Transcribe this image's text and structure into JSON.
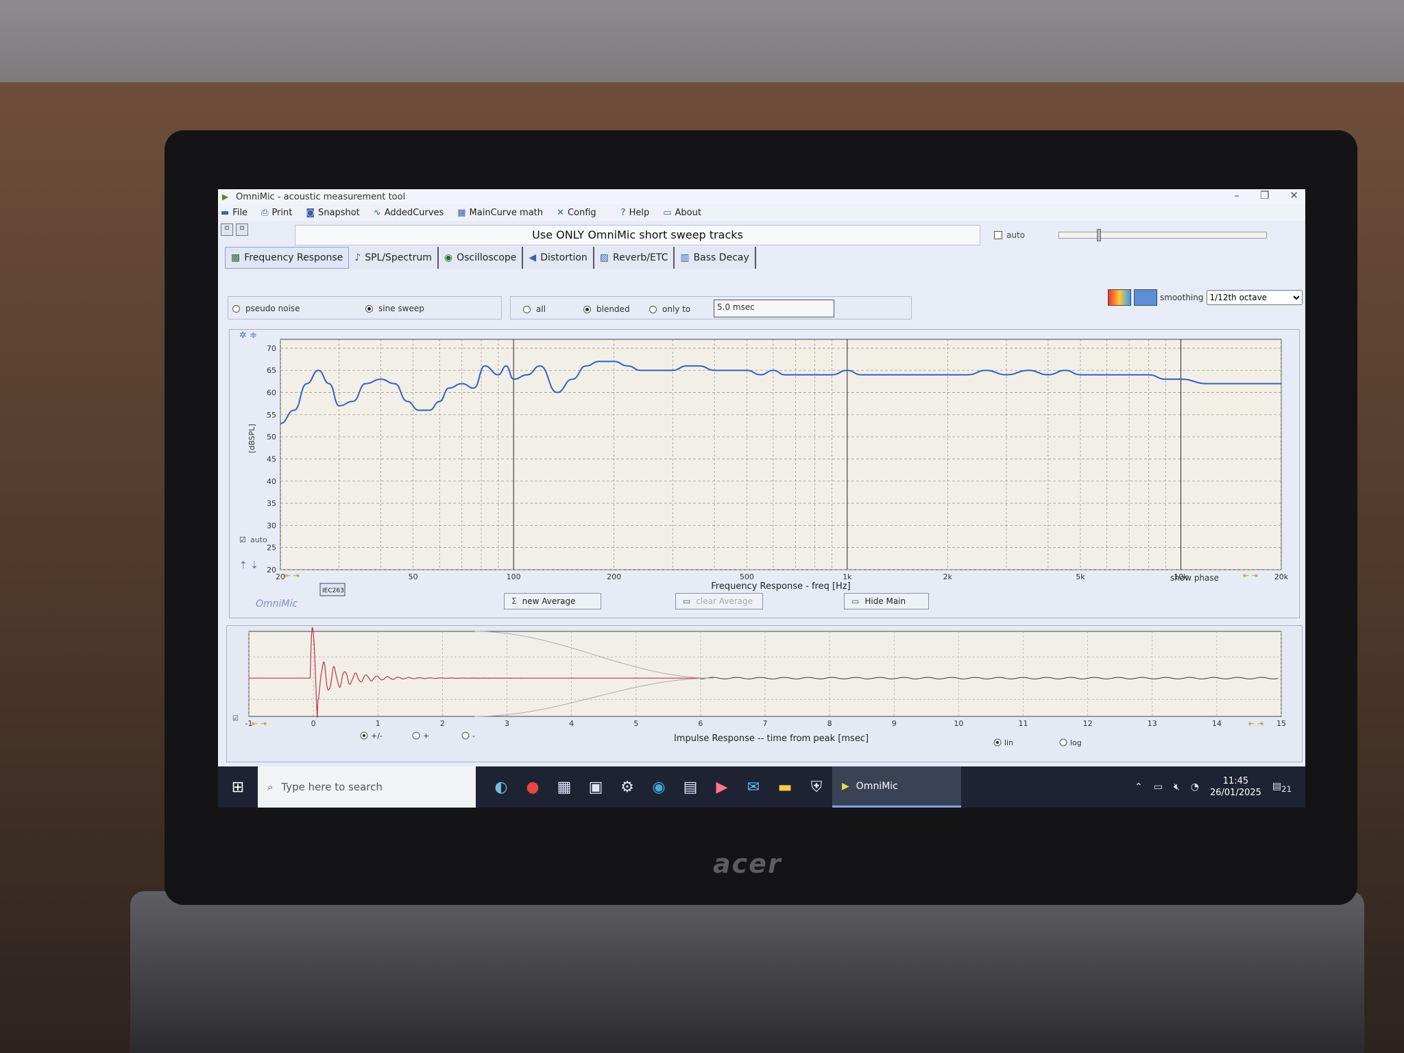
{
  "window": {
    "title": "OmniMic - acoustic measurement tool"
  },
  "menu": [
    {
      "icon": "folder-icon",
      "label": "File"
    },
    {
      "icon": "printer-icon",
      "label": "Print"
    },
    {
      "icon": "camera-icon",
      "label": "Snapshot"
    },
    {
      "icon": "curve-icon",
      "label": "AddedCurves"
    },
    {
      "icon": "calculator-icon",
      "label": "MainCurve math"
    },
    {
      "icon": "tools-icon",
      "label": "Config"
    },
    {
      "icon": "help-icon",
      "label": "Help"
    },
    {
      "icon": "chat-icon",
      "label": "About"
    }
  ],
  "banner": "Use ONLY OmniMic short sweep tracks",
  "auto_label": "auto",
  "tabs": [
    {
      "icon": "frequency-icon",
      "label": "Frequency Response",
      "active": true
    },
    {
      "icon": "spectrum-icon",
      "label": "SPL/Spectrum"
    },
    {
      "icon": "oscilloscope-icon",
      "label": "Oscilloscope"
    },
    {
      "icon": "distortion-icon",
      "label": "Distortion"
    },
    {
      "icon": "reverb-icon",
      "label": "Reverb/ETC"
    },
    {
      "icon": "bass-decay-icon",
      "label": "Bass Decay"
    }
  ],
  "signal": {
    "pseudo_noise": "pseudo noise",
    "sine_sweep": "sine sweep",
    "selected": "sine sweep"
  },
  "gating": {
    "all": "all",
    "blended": "blended",
    "only_to": "only to",
    "selected": "blended",
    "msec_value": "5.0 msec"
  },
  "smoothing": {
    "label": "smoothing",
    "value": "1/12th octave"
  },
  "freq_chart": {
    "y_ticks": [
      "70",
      "65",
      "60",
      "55",
      "50",
      "45",
      "40",
      "35",
      "30",
      "25",
      "20"
    ],
    "ylabel": "[dBSPL]",
    "x_ticks": [
      "20",
      "50",
      "100",
      "200",
      "500",
      "1k",
      "2k",
      "5k",
      "10k",
      "20k"
    ],
    "xlabel": "Frequency Response - freq [Hz]",
    "auto_label": "auto",
    "iec_label": "IEC263",
    "show_phase": "show phase",
    "logo": "OmniMic",
    "new_average": "new Average",
    "clear_average": "clear Average",
    "hide_main": "Hide Main"
  },
  "chart_data": [
    {
      "type": "line",
      "xscale": "log",
      "xlim": [
        20,
        20000
      ],
      "ylim": [
        20,
        72
      ],
      "ylabel": "[dBSPL]",
      "xlabel": "Frequency Response - freq [Hz]",
      "grid": true,
      "color": "#2f5fd0",
      "x": [
        20,
        22,
        24,
        26,
        28,
        30,
        33,
        36,
        40,
        44,
        48,
        52,
        56,
        60,
        64,
        70,
        76,
        82,
        90,
        95,
        100,
        110,
        120,
        135,
        150,
        165,
        180,
        190,
        200,
        220,
        240,
        260,
        280,
        300,
        330,
        360,
        400,
        450,
        500,
        550,
        600,
        650,
        700,
        800,
        900,
        1000,
        1100,
        1200,
        1400,
        1600,
        1800,
        2000,
        2300,
        2600,
        3000,
        3500,
        4000,
        4500,
        5000,
        6000,
        7000,
        8000,
        9000,
        10000,
        12000,
        14000,
        16000,
        18000,
        20000
      ],
      "y": [
        53,
        56,
        62,
        65,
        62,
        57,
        58,
        62,
        63,
        62,
        58,
        56,
        56,
        58,
        61,
        62,
        61,
        66,
        64,
        66,
        63,
        64,
        66,
        60,
        63,
        66,
        67,
        67,
        67,
        66,
        65,
        65,
        65,
        65,
        66,
        66,
        65,
        65,
        65,
        64,
        65,
        64,
        64,
        64,
        64,
        65,
        64,
        64,
        64,
        64,
        64,
        64,
        64,
        65,
        64,
        65,
        64,
        65,
        64,
        64,
        64,
        64,
        63,
        63,
        62,
        62,
        62,
        62,
        62
      ]
    },
    {
      "type": "line",
      "xlim": [
        -1,
        15
      ],
      "xlabel": "Impulse Response -- time from peak [msec]",
      "grid": true,
      "x_ticks": [
        "-1",
        "0",
        "1",
        "2",
        "3",
        "4",
        "5",
        "6",
        "7",
        "8",
        "9",
        "10",
        "11",
        "12",
        "13",
        "14",
        "15"
      ]
    }
  ],
  "impulse": {
    "xlabel": "Impulse Response -- time from peak [msec]",
    "pm": "+/-",
    "plus": "+",
    "minus": "-",
    "lin": "lin",
    "log": "log"
  },
  "taskbar": {
    "search_placeholder": "Type here to search",
    "app": "OmniMic",
    "time": "11:45",
    "date": "26/01/2025",
    "notif": "21"
  }
}
